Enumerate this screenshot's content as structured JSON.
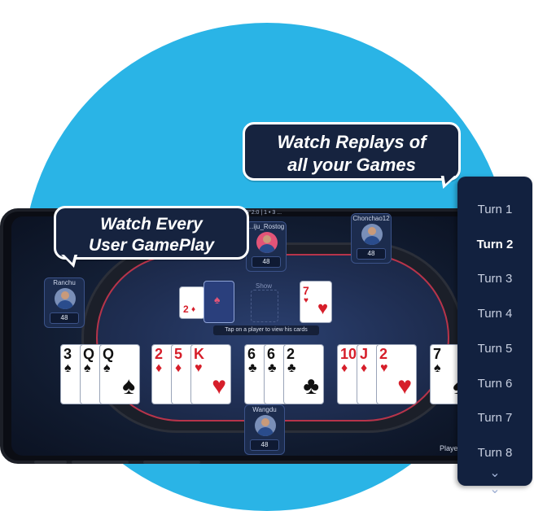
{
  "bubbles": {
    "gameplay": [
      "Watch Every",
      "User GamePlay"
    ],
    "replays": [
      "Watch Replays of",
      "all your Games"
    ]
  },
  "table": {
    "top_info": "&#8203;8°2...0 | 1 • 3 ...",
    "hint": "Tap on a player to view his cards",
    "show_label": "Show",
    "joker_label": "2"
  },
  "players": [
    {
      "name": "Ranchu",
      "score": "48"
    },
    {
      "name": "...iju_Rostog",
      "score": "48"
    },
    {
      "name": "Chonchao12",
      "score": "48"
    },
    {
      "name": "Wangdu",
      "score": "48"
    }
  ],
  "table_cards": [
    {
      "rank": "2",
      "suit": "♦",
      "color": "red"
    },
    {
      "rank": "7",
      "suit": "♥",
      "color": "red"
    }
  ],
  "hand": [
    {
      "rank": "3",
      "suit": "♠",
      "color": "blk"
    },
    {
      "rank": "Q",
      "suit": "♠",
      "color": "blk"
    },
    {
      "rank": "Q",
      "suit": "♠",
      "color": "blk"
    },
    {
      "rank": "2",
      "suit": "♦",
      "color": "red"
    },
    {
      "rank": "5",
      "suit": "♦",
      "color": "red"
    },
    {
      "rank": "K",
      "suit": "♥",
      "color": "red"
    },
    {
      "rank": "6",
      "suit": "♣",
      "color": "blk"
    },
    {
      "rank": "6",
      "suit": "♣",
      "color": "blk"
    },
    {
      "rank": "2",
      "suit": "♣",
      "color": "blk"
    },
    {
      "rank": "10",
      "suit": "♦",
      "color": "red"
    },
    {
      "rank": "J",
      "suit": "♦",
      "color": "red"
    },
    {
      "rank": "2",
      "suit": "♥",
      "color": "red"
    },
    {
      "rank": "7",
      "suit": "♠",
      "color": "blk"
    }
  ],
  "players_label": "Playe",
  "turns": [
    "Turn 1",
    "Turn 2",
    "Turn 3",
    "Turn 4",
    "Turn 5",
    "Turn 6",
    "Turn 7",
    "Turn 8"
  ],
  "active_turn": "Turn 2",
  "icons": {
    "more_turns": "chevron-double-down-icon"
  },
  "colors": {
    "circle": "#2ab4e6",
    "panel": "#12213f",
    "felt": "#1f2e52",
    "rail_accent": "#b7344a"
  }
}
